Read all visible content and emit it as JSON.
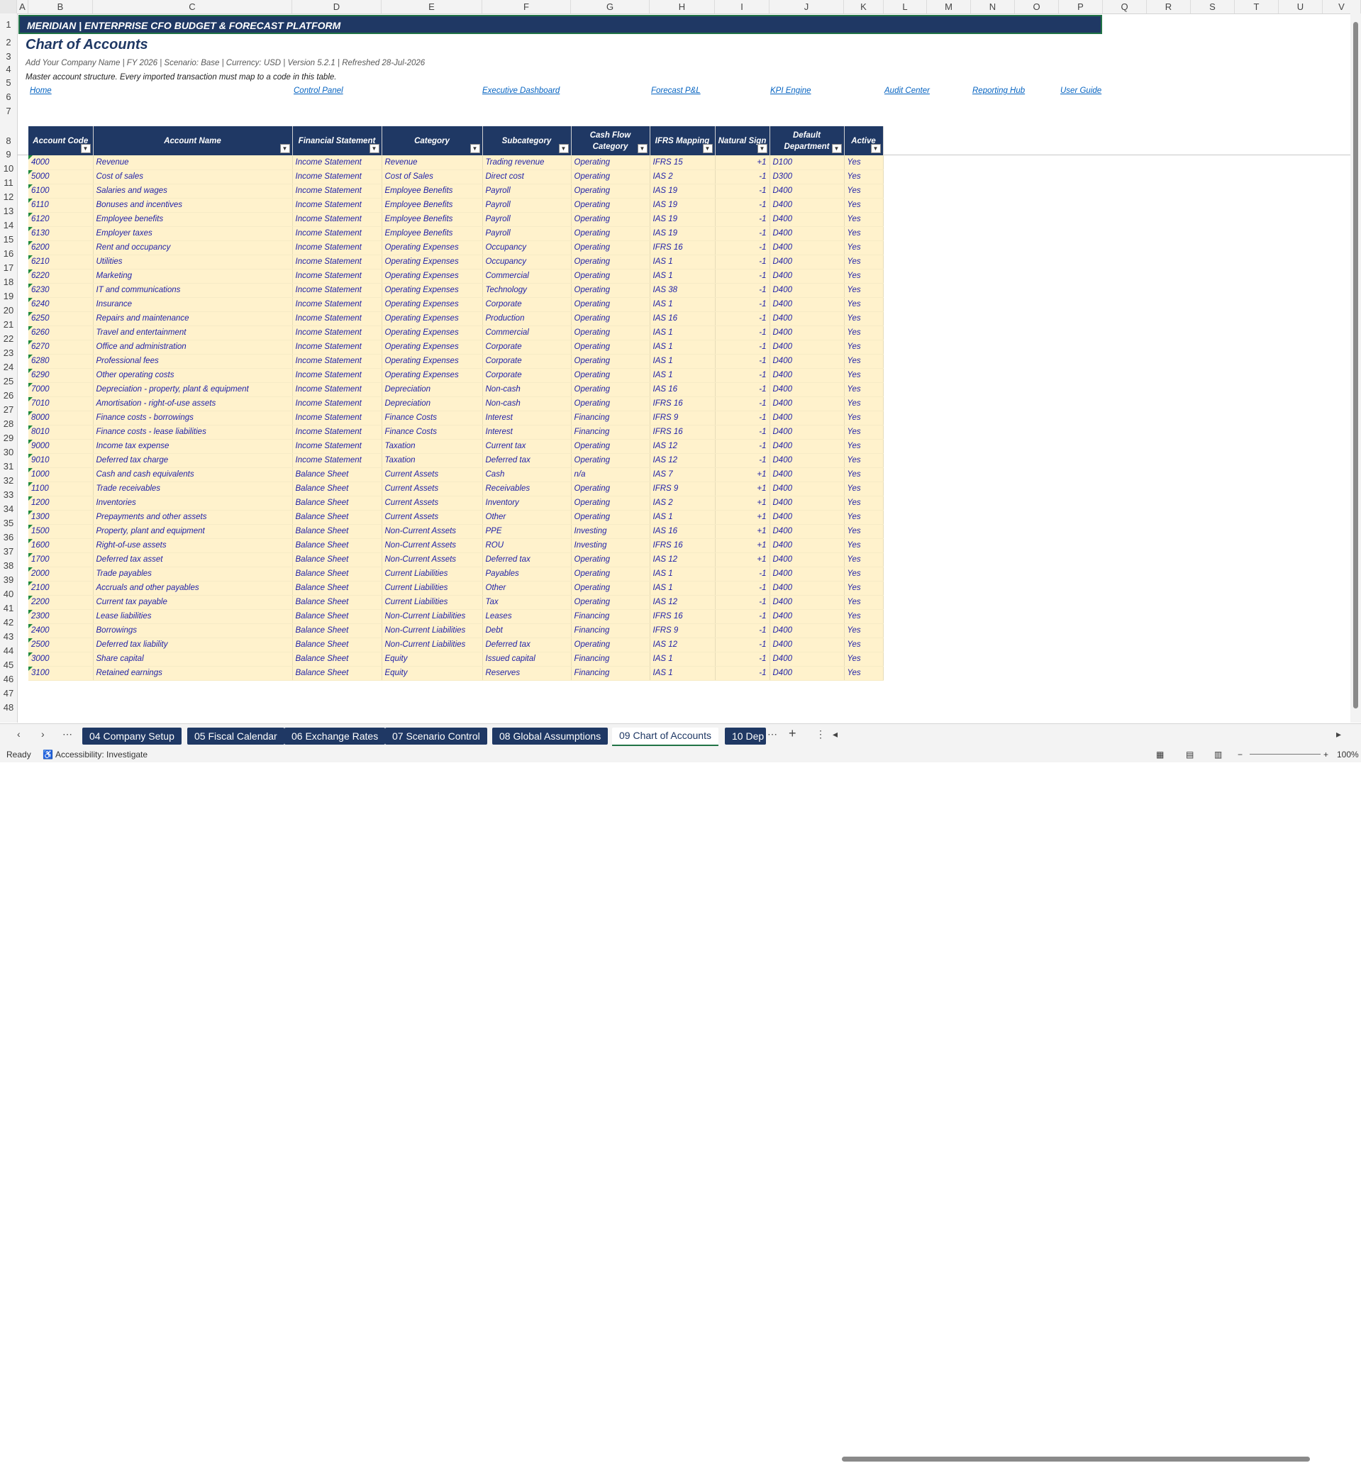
{
  "columns": [
    "A",
    "B",
    "C",
    "D",
    "E",
    "F",
    "G",
    "H",
    "I",
    "J",
    "K",
    "L",
    "M",
    "N",
    "O",
    "P",
    "Q",
    "R",
    "S",
    "T",
    "U",
    "V"
  ],
  "banner": "MERIDIAN  |  ENTERPRISE CFO BUDGET & FORECAST PLATFORM",
  "title": "Chart of Accounts",
  "meta": "Add Your Company Name   |   FY 2026   |   Scenario: Base   |   Currency: USD   |   Version 5.2.1   |   Refreshed 28-Jul-2026",
  "note": "Master account structure. Every imported transaction must map to a code in this table.",
  "links": [
    "Home",
    "Control Panel",
    "Executive Dashboard",
    "Forecast P&L",
    "KPI Engine",
    "Audit Center",
    "Reporting Hub",
    "User Guide"
  ],
  "headers": [
    "Account Code",
    "Account Name",
    "Financial Statement",
    "Category",
    "Subcategory",
    "Cash Flow Category",
    "IFRS Mapping",
    "Natural Sign",
    "Default Department",
    "Active"
  ],
  "rows": [
    [
      "4000",
      "Revenue",
      "Income Statement",
      "Revenue",
      "Trading revenue",
      "Operating",
      "IFRS 15",
      "+1",
      "D100",
      "Yes"
    ],
    [
      "5000",
      "Cost of sales",
      "Income Statement",
      "Cost of Sales",
      "Direct cost",
      "Operating",
      "IAS 2",
      "-1",
      "D300",
      "Yes"
    ],
    [
      "6100",
      "Salaries and wages",
      "Income Statement",
      "Employee Benefits",
      "Payroll",
      "Operating",
      "IAS 19",
      "-1",
      "D400",
      "Yes"
    ],
    [
      "6110",
      "Bonuses and incentives",
      "Income Statement",
      "Employee Benefits",
      "Payroll",
      "Operating",
      "IAS 19",
      "-1",
      "D400",
      "Yes"
    ],
    [
      "6120",
      "Employee benefits",
      "Income Statement",
      "Employee Benefits",
      "Payroll",
      "Operating",
      "IAS 19",
      "-1",
      "D400",
      "Yes"
    ],
    [
      "6130",
      "Employer taxes",
      "Income Statement",
      "Employee Benefits",
      "Payroll",
      "Operating",
      "IAS 19",
      "-1",
      "D400",
      "Yes"
    ],
    [
      "6200",
      "Rent and occupancy",
      "Income Statement",
      "Operating Expenses",
      "Occupancy",
      "Operating",
      "IFRS 16",
      "-1",
      "D400",
      "Yes"
    ],
    [
      "6210",
      "Utilities",
      "Income Statement",
      "Operating Expenses",
      "Occupancy",
      "Operating",
      "IAS 1",
      "-1",
      "D400",
      "Yes"
    ],
    [
      "6220",
      "Marketing",
      "Income Statement",
      "Operating Expenses",
      "Commercial",
      "Operating",
      "IAS 1",
      "-1",
      "D400",
      "Yes"
    ],
    [
      "6230",
      "IT and communications",
      "Income Statement",
      "Operating Expenses",
      "Technology",
      "Operating",
      "IAS 38",
      "-1",
      "D400",
      "Yes"
    ],
    [
      "6240",
      "Insurance",
      "Income Statement",
      "Operating Expenses",
      "Corporate",
      "Operating",
      "IAS 1",
      "-1",
      "D400",
      "Yes"
    ],
    [
      "6250",
      "Repairs and maintenance",
      "Income Statement",
      "Operating Expenses",
      "Production",
      "Operating",
      "IAS 16",
      "-1",
      "D400",
      "Yes"
    ],
    [
      "6260",
      "Travel and entertainment",
      "Income Statement",
      "Operating Expenses",
      "Commercial",
      "Operating",
      "IAS 1",
      "-1",
      "D400",
      "Yes"
    ],
    [
      "6270",
      "Office and administration",
      "Income Statement",
      "Operating Expenses",
      "Corporate",
      "Operating",
      "IAS 1",
      "-1",
      "D400",
      "Yes"
    ],
    [
      "6280",
      "Professional fees",
      "Income Statement",
      "Operating Expenses",
      "Corporate",
      "Operating",
      "IAS 1",
      "-1",
      "D400",
      "Yes"
    ],
    [
      "6290",
      "Other operating costs",
      "Income Statement",
      "Operating Expenses",
      "Corporate",
      "Operating",
      "IAS 1",
      "-1",
      "D400",
      "Yes"
    ],
    [
      "7000",
      "Depreciation - property, plant & equipment",
      "Income Statement",
      "Depreciation",
      "Non-cash",
      "Operating",
      "IAS 16",
      "-1",
      "D400",
      "Yes"
    ],
    [
      "7010",
      "Amortisation - right-of-use assets",
      "Income Statement",
      "Depreciation",
      "Non-cash",
      "Operating",
      "IFRS 16",
      "-1",
      "D400",
      "Yes"
    ],
    [
      "8000",
      "Finance costs - borrowings",
      "Income Statement",
      "Finance Costs",
      "Interest",
      "Financing",
      "IFRS 9",
      "-1",
      "D400",
      "Yes"
    ],
    [
      "8010",
      "Finance costs - lease liabilities",
      "Income Statement",
      "Finance Costs",
      "Interest",
      "Financing",
      "IFRS 16",
      "-1",
      "D400",
      "Yes"
    ],
    [
      "9000",
      "Income tax expense",
      "Income Statement",
      "Taxation",
      "Current tax",
      "Operating",
      "IAS 12",
      "-1",
      "D400",
      "Yes"
    ],
    [
      "9010",
      "Deferred tax charge",
      "Income Statement",
      "Taxation",
      "Deferred tax",
      "Operating",
      "IAS 12",
      "-1",
      "D400",
      "Yes"
    ],
    [
      "1000",
      "Cash and cash equivalents",
      "Balance Sheet",
      "Current Assets",
      "Cash",
      "n/a",
      "IAS 7",
      "+1",
      "D400",
      "Yes"
    ],
    [
      "1100",
      "Trade receivables",
      "Balance Sheet",
      "Current Assets",
      "Receivables",
      "Operating",
      "IFRS 9",
      "+1",
      "D400",
      "Yes"
    ],
    [
      "1200",
      "Inventories",
      "Balance Sheet",
      "Current Assets",
      "Inventory",
      "Operating",
      "IAS 2",
      "+1",
      "D400",
      "Yes"
    ],
    [
      "1300",
      "Prepayments and other assets",
      "Balance Sheet",
      "Current Assets",
      "Other",
      "Operating",
      "IAS 1",
      "+1",
      "D400",
      "Yes"
    ],
    [
      "1500",
      "Property, plant and equipment",
      "Balance Sheet",
      "Non-Current Assets",
      "PPE",
      "Investing",
      "IAS 16",
      "+1",
      "D400",
      "Yes"
    ],
    [
      "1600",
      "Right-of-use assets",
      "Balance Sheet",
      "Non-Current Assets",
      "ROU",
      "Investing",
      "IFRS 16",
      "+1",
      "D400",
      "Yes"
    ],
    [
      "1700",
      "Deferred tax asset",
      "Balance Sheet",
      "Non-Current Assets",
      "Deferred tax",
      "Operating",
      "IAS 12",
      "+1",
      "D400",
      "Yes"
    ],
    [
      "2000",
      "Trade payables",
      "Balance Sheet",
      "Current Liabilities",
      "Payables",
      "Operating",
      "IAS 1",
      "-1",
      "D400",
      "Yes"
    ],
    [
      "2100",
      "Accruals and other payables",
      "Balance Sheet",
      "Current Liabilities",
      "Other",
      "Operating",
      "IAS 1",
      "-1",
      "D400",
      "Yes"
    ],
    [
      "2200",
      "Current tax payable",
      "Balance Sheet",
      "Current Liabilities",
      "Tax",
      "Operating",
      "IAS 12",
      "-1",
      "D400",
      "Yes"
    ],
    [
      "2300",
      "Lease liabilities",
      "Balance Sheet",
      "Non-Current Liabilities",
      "Leases",
      "Financing",
      "IFRS 16",
      "-1",
      "D400",
      "Yes"
    ],
    [
      "2400",
      "Borrowings",
      "Balance Sheet",
      "Non-Current Liabilities",
      "Debt",
      "Financing",
      "IFRS 9",
      "-1",
      "D400",
      "Yes"
    ],
    [
      "2500",
      "Deferred tax liability",
      "Balance Sheet",
      "Non-Current Liabilities",
      "Deferred tax",
      "Operating",
      "IAS 12",
      "-1",
      "D400",
      "Yes"
    ],
    [
      "3000",
      "Share capital",
      "Balance Sheet",
      "Equity",
      "Issued capital",
      "Financing",
      "IAS 1",
      "-1",
      "D400",
      "Yes"
    ],
    [
      "3100",
      "Retained earnings",
      "Balance Sheet",
      "Equity",
      "Reserves",
      "Financing",
      "IAS 1",
      "-1",
      "D400",
      "Yes"
    ]
  ],
  "tabs": [
    "04 Company Setup",
    "05 Fiscal Calendar",
    "06 Exchange Rates",
    "07 Scenario Control",
    "08 Global Assumptions",
    "09 Chart of Accounts",
    "10 Dep"
  ],
  "active_tab": "09 Chart of Accounts",
  "status": {
    "ready": "Ready",
    "accessibility": "Accessibility: Investigate",
    "zoom": "100%"
  },
  "icons": {
    "filter": "filter-dropdown-icon",
    "add_sheet": "plus-icon",
    "more": "ellipsis-icon",
    "accessibility": "accessibility-icon"
  }
}
